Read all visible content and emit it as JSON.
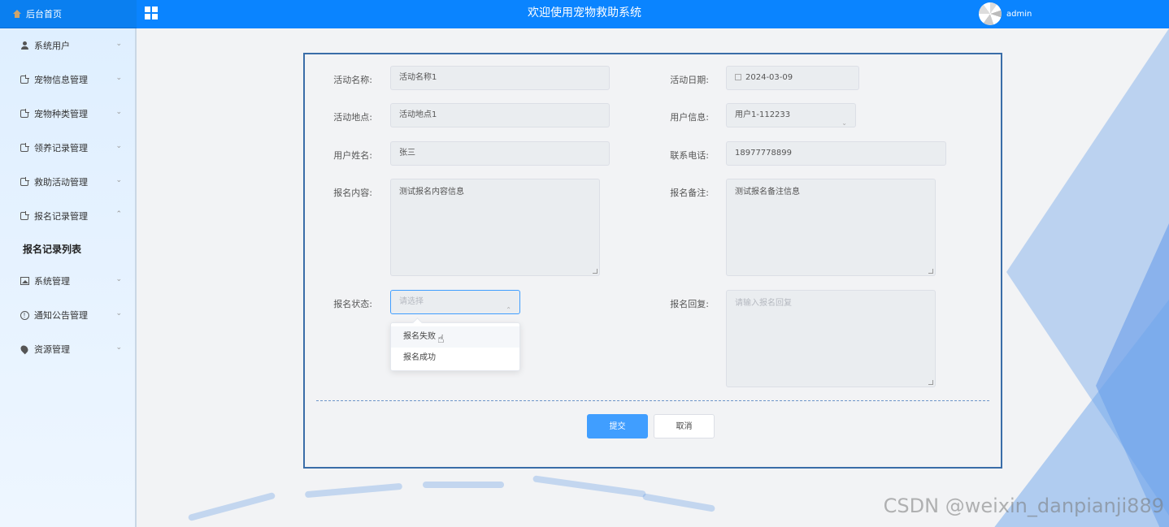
{
  "topbar": {
    "home_label": "后台首页",
    "title": "欢迎使用宠物救助系统",
    "username": "admin"
  },
  "sidebar": {
    "items": [
      {
        "label": "系统用户",
        "icon": "user-icon"
      },
      {
        "label": "宠物信息管理",
        "icon": "doc-icon"
      },
      {
        "label": "宠物种类管理",
        "icon": "doc-icon"
      },
      {
        "label": "领养记录管理",
        "icon": "doc-icon"
      },
      {
        "label": "救助活动管理",
        "icon": "doc-icon"
      },
      {
        "label": "报名记录管理",
        "icon": "doc-icon",
        "expanded": true
      },
      {
        "label": "系统管理",
        "icon": "picture-icon"
      },
      {
        "label": "通知公告管理",
        "icon": "info-icon"
      },
      {
        "label": "资源管理",
        "icon": "pin-icon"
      }
    ],
    "sub_item": "报名记录列表"
  },
  "form": {
    "activity_name": {
      "label": "活动名称:",
      "value": "活动名称1"
    },
    "activity_date": {
      "label": "活动日期:",
      "value": "2024-03-09"
    },
    "activity_location": {
      "label": "活动地点:",
      "value": "活动地点1"
    },
    "user_info": {
      "label": "用户信息:",
      "value": "用户1-112233"
    },
    "user_name": {
      "label": "用户姓名:",
      "value": "张三"
    },
    "phone": {
      "label": "联系电话:",
      "value": "18977778899"
    },
    "signup_content": {
      "label": "报名内容:",
      "value": "测试报名内容信息"
    },
    "signup_note": {
      "label": "报名备注:",
      "value": "测试报名备注信息"
    },
    "signup_status": {
      "label": "报名状态:",
      "placeholder": "请选择",
      "options": [
        "报名失败",
        "报名成功"
      ]
    },
    "signup_reply": {
      "label": "报名回复:",
      "placeholder": "请输入报名回复"
    },
    "submit_label": "提交",
    "cancel_label": "取消"
  },
  "watermark": "CSDN @weixin_danpianji889",
  "colors": {
    "accent": "#0a84ff",
    "primary_button": "#409eff",
    "card_border": "#3a6da8"
  }
}
